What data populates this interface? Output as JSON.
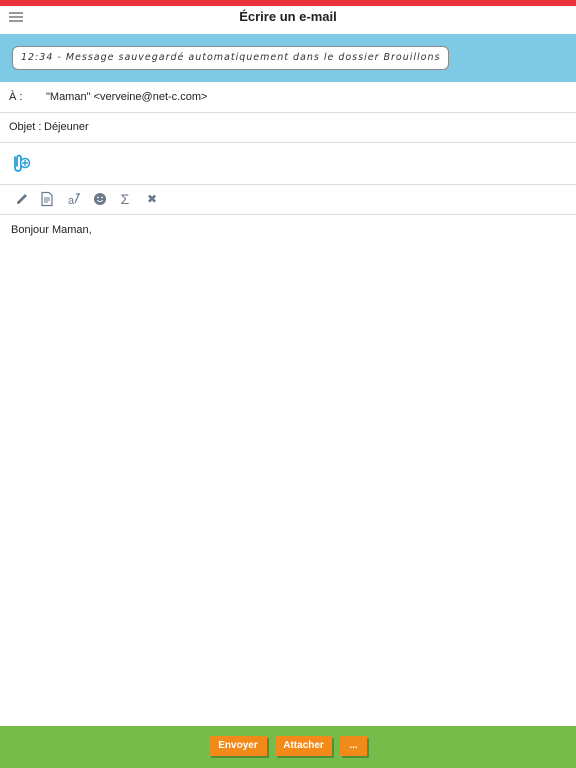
{
  "header": {
    "title": "Écrire un e-mail"
  },
  "banner": {
    "message": "12:34 - Message sauvegardé automatiquement dans le dossier Brouillons"
  },
  "compose": {
    "to_label": "À :",
    "to_value": "\"Maman\" <verveine@net-c.com>",
    "subject_label": "Objet :",
    "subject_value": "Déjeuner",
    "body": "Bonjour Maman,"
  },
  "toolbar": {
    "sigma": "Σ",
    "close": "✖"
  },
  "footer": {
    "send_label": "Envoyer",
    "attach_label": "Attacher",
    "more_label": "..."
  },
  "colors": {
    "accent_red": "#e8323c",
    "banner_blue": "#7ec9e3",
    "footer_green": "#76bc4a",
    "button_orange": "#f28a1a"
  },
  "icons": [
    "menu-icon",
    "paperclip-add-icon",
    "pencil-icon",
    "document-icon",
    "text-format-icon",
    "smiley-icon",
    "sigma-icon",
    "close-icon"
  ]
}
